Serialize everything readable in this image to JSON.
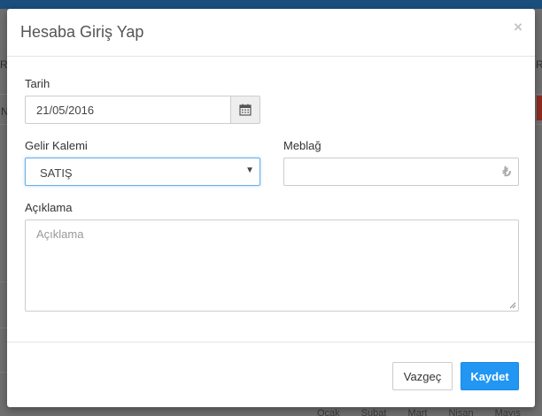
{
  "background": {
    "edge_letters": {
      "left_top": "R",
      "left_mid": "N",
      "right_top": "R"
    },
    "footer_months": [
      "Ocak",
      "Şubat",
      "Mart",
      "Nisan",
      "Mayıs"
    ]
  },
  "modal": {
    "title": "Hesaba Giriş Yap",
    "close_label": "×"
  },
  "form": {
    "date": {
      "label": "Tarih",
      "value": "21/05/2016"
    },
    "category": {
      "label": "Gelir Kalemi",
      "selected": "SATIŞ"
    },
    "amount": {
      "label": "Meblağ",
      "value": "",
      "currency_symbol": "₺"
    },
    "description": {
      "label": "Açıklama",
      "value": "",
      "placeholder": "Açıklama"
    }
  },
  "footer": {
    "cancel_label": "Vazgeç",
    "save_label": "Kaydet"
  },
  "colors": {
    "primary": "#2196f3",
    "focus_border": "#66afe9"
  },
  "icons": {
    "date_addon": "calendar-icon",
    "currency": "turkish-lira-icon",
    "select": "caret-down-icon"
  }
}
